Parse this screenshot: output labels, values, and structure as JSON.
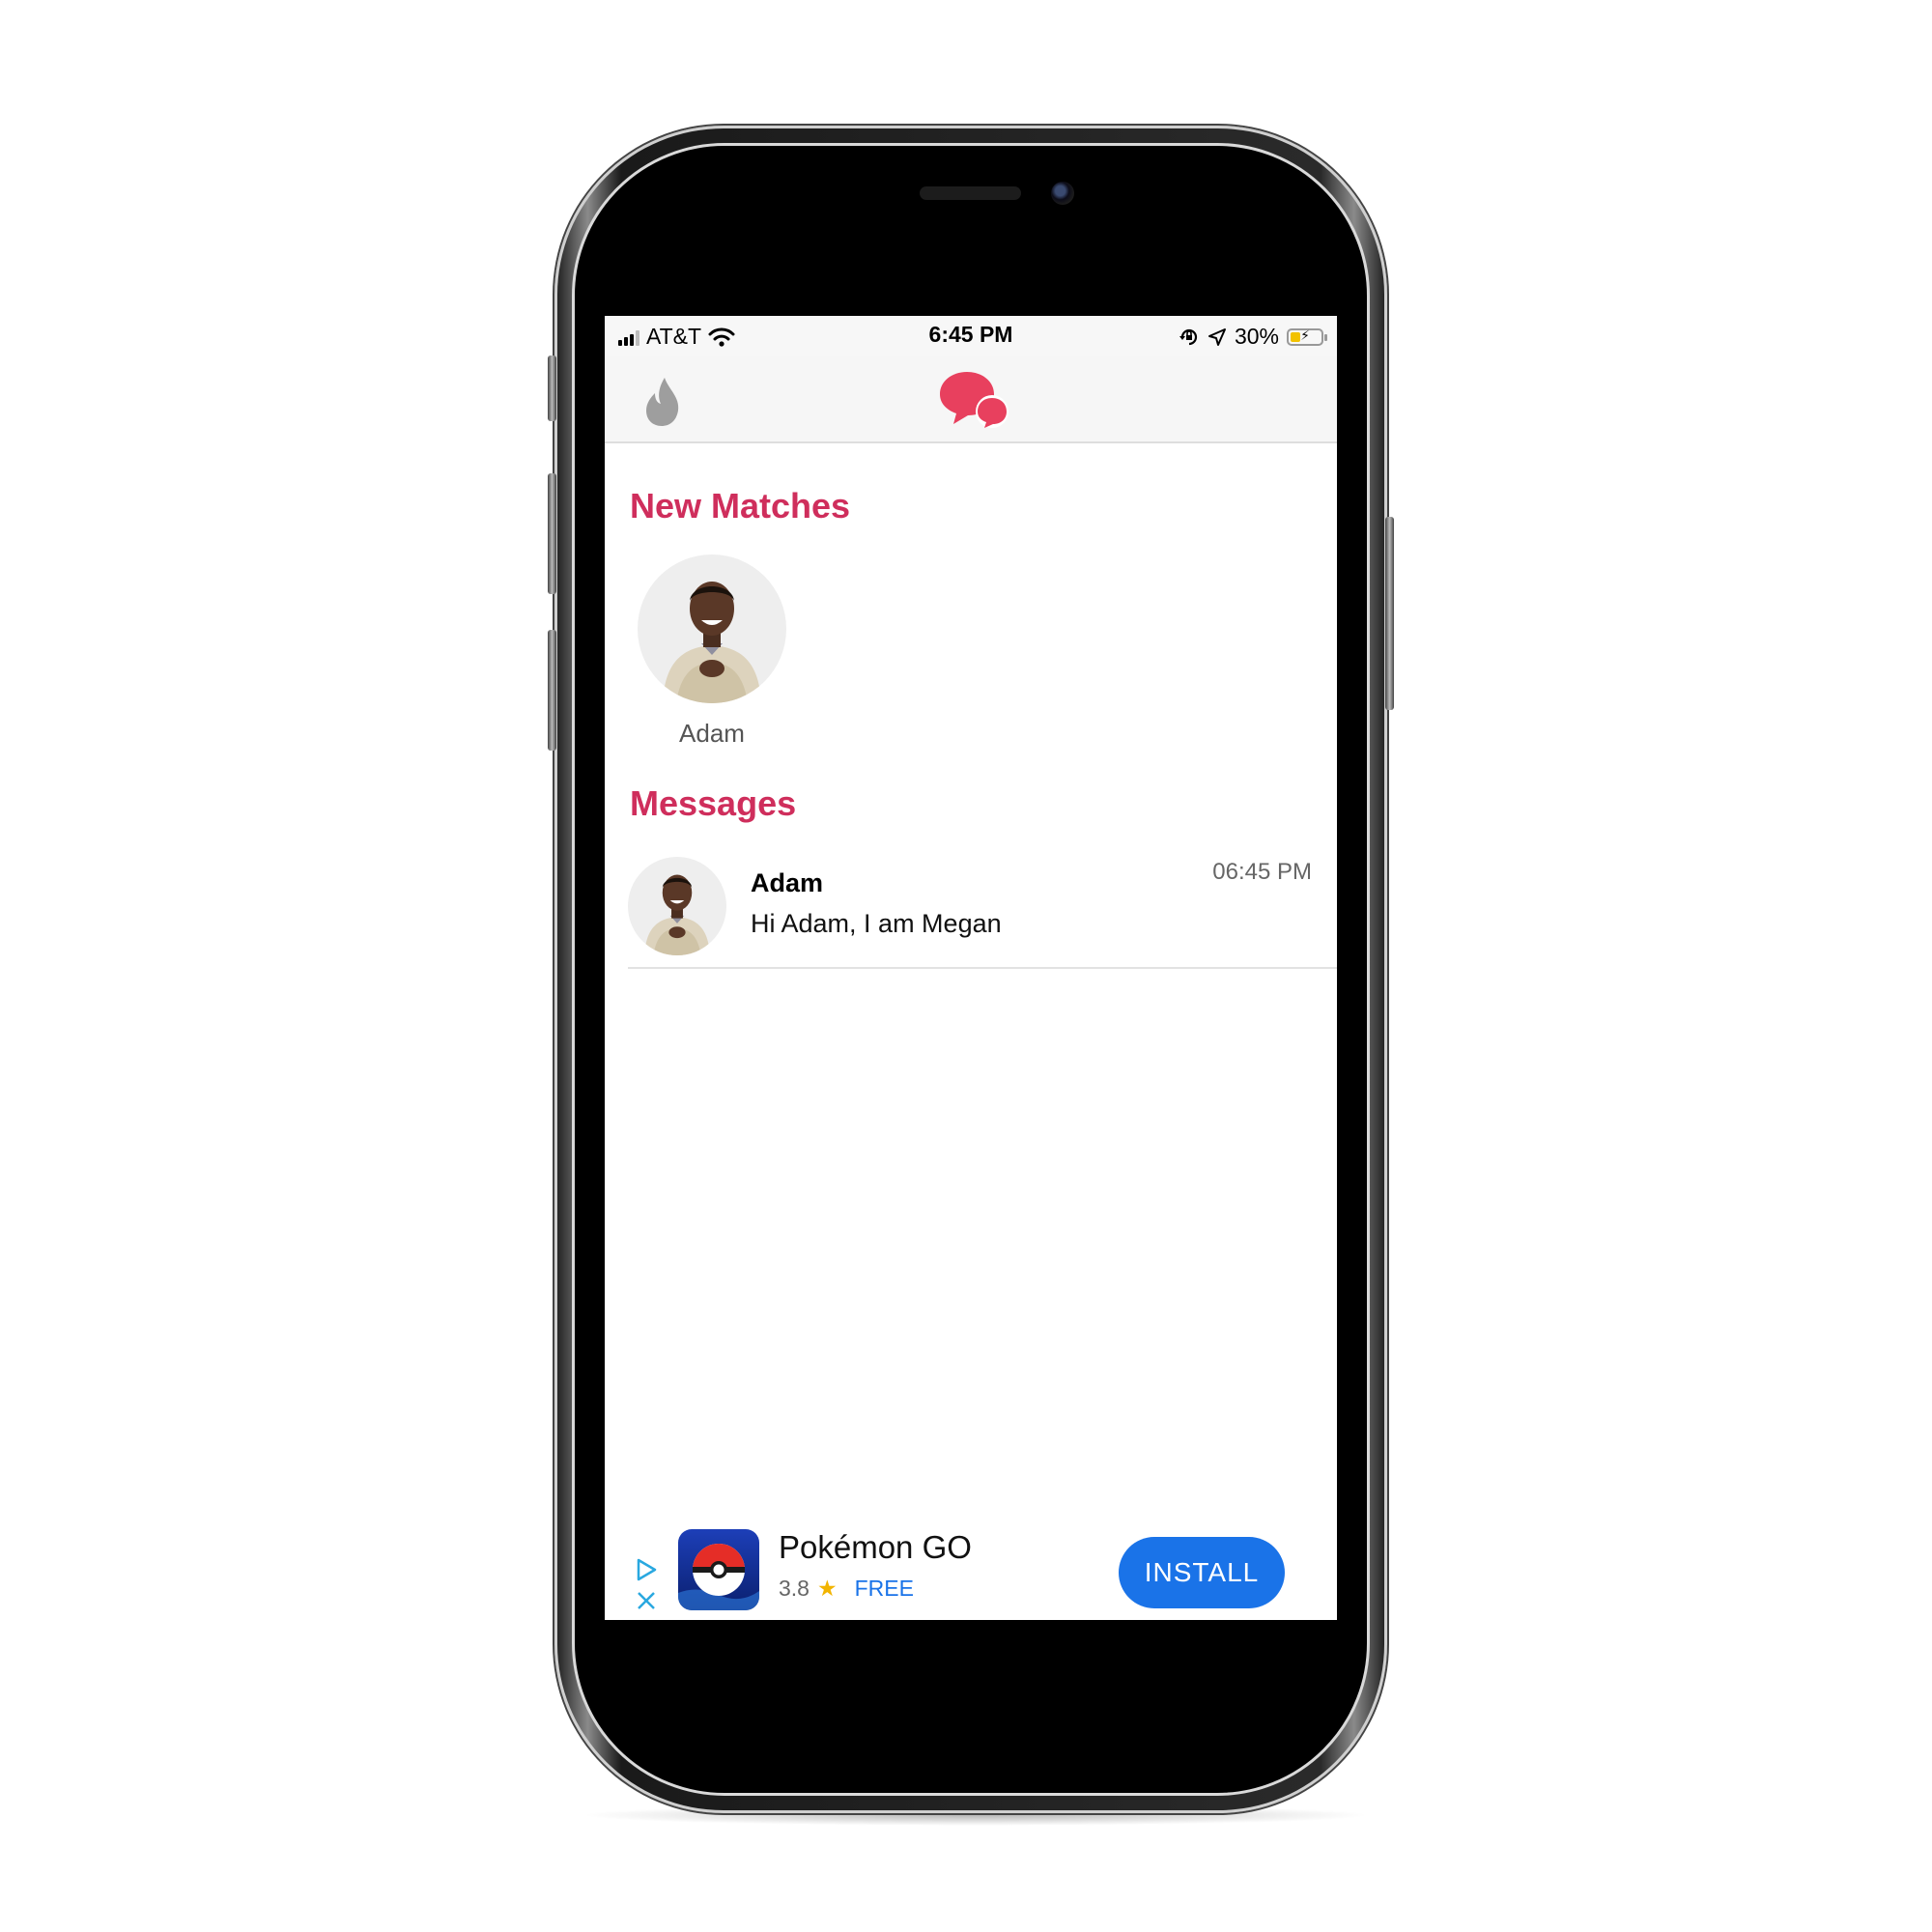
{
  "status_bar": {
    "carrier": "AT&T",
    "time": "6:45 PM",
    "battery_percent": "30%",
    "battery_level": 0.3,
    "battery_color": "#f2c200",
    "icons": [
      "signal-icon",
      "wifi-icon",
      "orientation-lock-icon",
      "location-arrow-icon",
      "battery-charging-icon"
    ]
  },
  "nav": {
    "left_icon": "flame-icon",
    "center_icon": "chat-bubbles-icon",
    "accent_color": "#e8405e"
  },
  "new_matches": {
    "title": "New Matches",
    "items": [
      {
        "name": "Adam",
        "avatar": "profile-photo"
      }
    ]
  },
  "messages": {
    "title": "Messages",
    "items": [
      {
        "name": "Adam",
        "preview": "Hi Adam, I am Megan",
        "time": "06:45 PM",
        "avatar": "profile-photo"
      }
    ]
  },
  "ad": {
    "app_name": "Pokémon GO",
    "rating": "3.8",
    "price": "FREE",
    "install_label": "INSTALL",
    "icons": [
      "adchoices-icon",
      "close-icon",
      "app-icon",
      "star-icon"
    ],
    "button_color": "#1a73e8"
  },
  "theme": {
    "section_title_color": "#cf2e5c"
  }
}
